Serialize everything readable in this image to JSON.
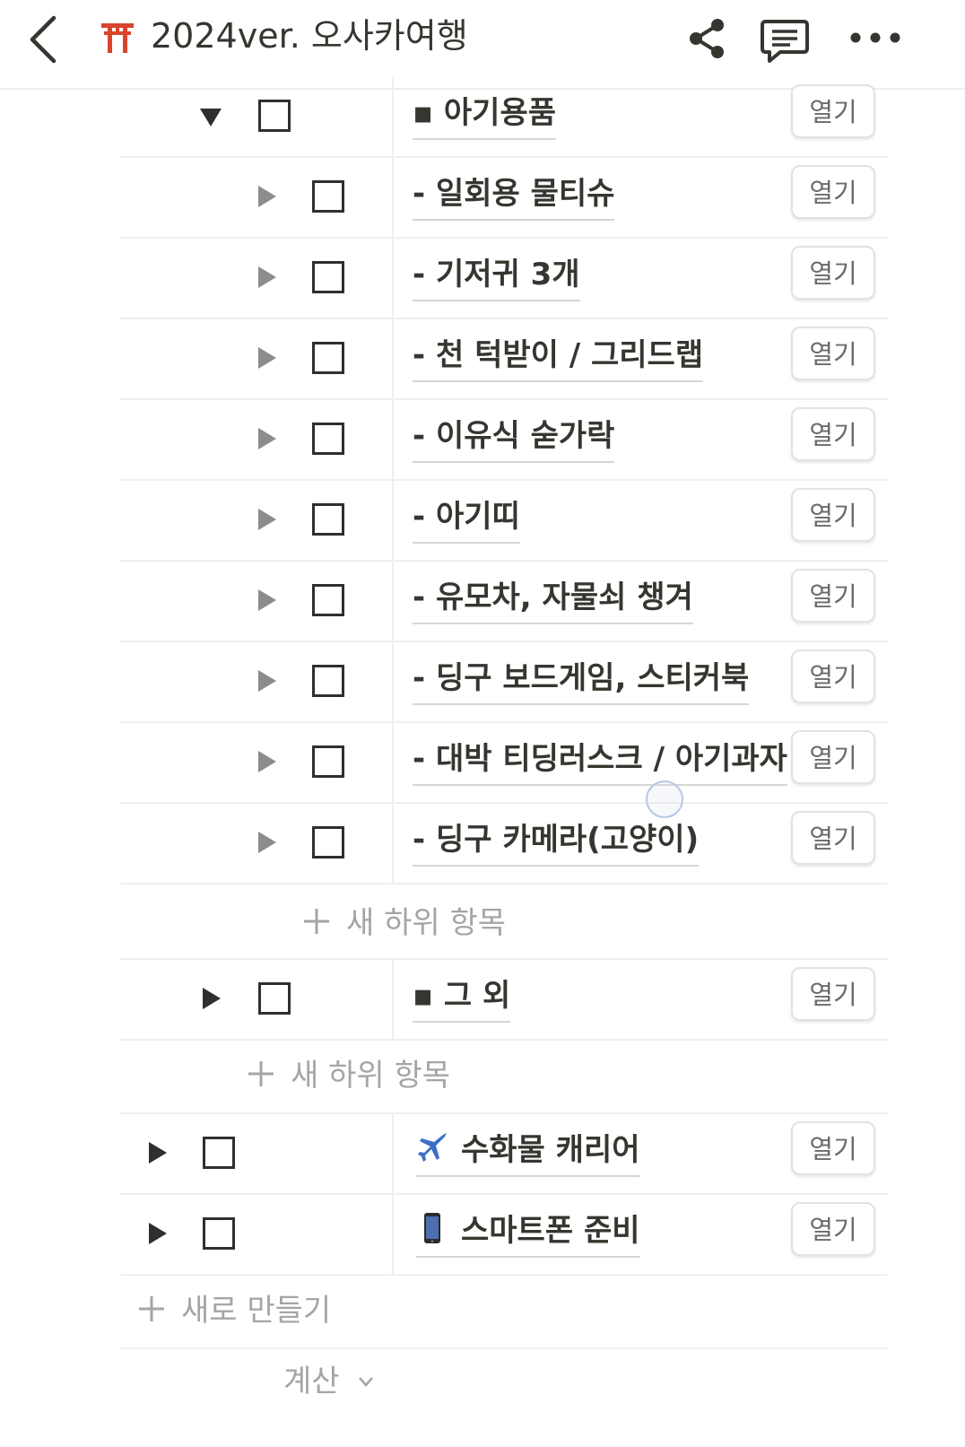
{
  "header": {
    "title": "2024ver. 오사카여행",
    "page_icon": "torii-gate-icon",
    "actions": [
      "back-icon",
      "share-icon",
      "comment-icon",
      "more-icon"
    ]
  },
  "rows": [
    {
      "title": "▪ 아기용품",
      "open": "열기",
      "toggle": "expanded"
    },
    {
      "title": "- 일회용 물티슈",
      "open": "열기",
      "toggle": "collapsed"
    },
    {
      "title": "- 기저귀 3개",
      "open": "열기",
      "toggle": "collapsed"
    },
    {
      "title": "- 천 턱받이 / 그리드랩",
      "open": "열기",
      "toggle": "collapsed"
    },
    {
      "title": "- 이유식 숟가락",
      "open": "열기",
      "toggle": "collapsed"
    },
    {
      "title": "- 아기띠",
      "open": "열기",
      "toggle": "collapsed"
    },
    {
      "title": "- 유모차, 자물쇠 챙겨",
      "open": "열기",
      "toggle": "collapsed"
    },
    {
      "title": "- 딩구 보드게임, 스티커북",
      "open": "열기",
      "toggle": "collapsed"
    },
    {
      "title": "- 대박 티딩러스크 / 아기과자",
      "open": "열기",
      "toggle": "collapsed"
    },
    {
      "title": "- 딩구 카메라(고양이)",
      "open": "열기",
      "toggle": "collapsed"
    },
    {
      "title": "▪ 그 외",
      "open": "열기",
      "toggle": "collapsed"
    },
    {
      "title": "수화물 캐리어",
      "icon": "airplane-icon",
      "open": "열기",
      "toggle": "collapsed"
    },
    {
      "title": "스마트폰 준비",
      "icon": "smartphone-icon",
      "open": "열기",
      "toggle": "collapsed"
    }
  ],
  "add_subitem": "새 하위 항목",
  "add_new": "새로 만들기",
  "calculate": "계산",
  "colors": {
    "text": "#37352f",
    "muted": "#a5a5a2",
    "divider": "#efefee",
    "torii": "#d9442e",
    "toggle": "#8c8c8a"
  }
}
